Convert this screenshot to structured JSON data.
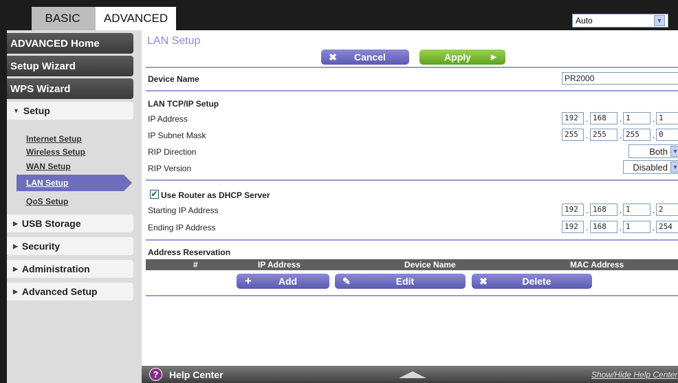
{
  "tabs": {
    "basic": "BASIC",
    "advanced": "ADVANCED"
  },
  "language": {
    "selected": "Auto"
  },
  "sidebar": {
    "advanced_home": "ADVANCED Home",
    "setup_wizard": "Setup Wizard",
    "wps_wizard": "WPS Wizard",
    "setup": "Setup",
    "setup_items": [
      "Internet Setup",
      "Wireless Setup",
      "WAN Setup",
      "LAN Setup",
      "QoS Setup"
    ],
    "usb_storage": "USB Storage",
    "security": "Security",
    "administration": "Administration",
    "advanced_setup": "Advanced Setup"
  },
  "page": {
    "title": "LAN Setup"
  },
  "buttons": {
    "cancel": "Cancel",
    "apply": "Apply",
    "add": "Add",
    "edit": "Edit",
    "delete": "Delete"
  },
  "device_name": {
    "label": "Device Name",
    "value": "PR2000"
  },
  "lan": {
    "section": "LAN TCP/IP Setup",
    "ip_label": "IP Address",
    "ip": [
      "192",
      "168",
      "1",
      "1"
    ],
    "mask_label": "IP Subnet Mask",
    "mask": [
      "255",
      "255",
      "255",
      "0"
    ],
    "rip_dir_label": "RIP Direction",
    "rip_dir": "Both",
    "rip_ver_label": "RIP Version",
    "rip_ver": "Disabled"
  },
  "dhcp": {
    "checkbox_label": "Use Router as DHCP Server",
    "checked": true,
    "start_label": "Starting IP Address",
    "start": [
      "192",
      "168",
      "1",
      "2"
    ],
    "end_label": "Ending IP Address",
    "end": [
      "192",
      "168",
      "1",
      "254"
    ]
  },
  "reservation": {
    "title": "Address Reservation",
    "columns": [
      "#",
      "IP Address",
      "Device Name",
      "MAC Address"
    ]
  },
  "help": {
    "title": "Help Center",
    "toggle": "Show/Hide Help Center"
  },
  "icons": {
    "help": "help-question-icon",
    "cancel": "x-icon",
    "apply": "arrow-right-icon",
    "add": "plus-icon",
    "edit": "pencil-icon",
    "delete": "x-icon"
  }
}
